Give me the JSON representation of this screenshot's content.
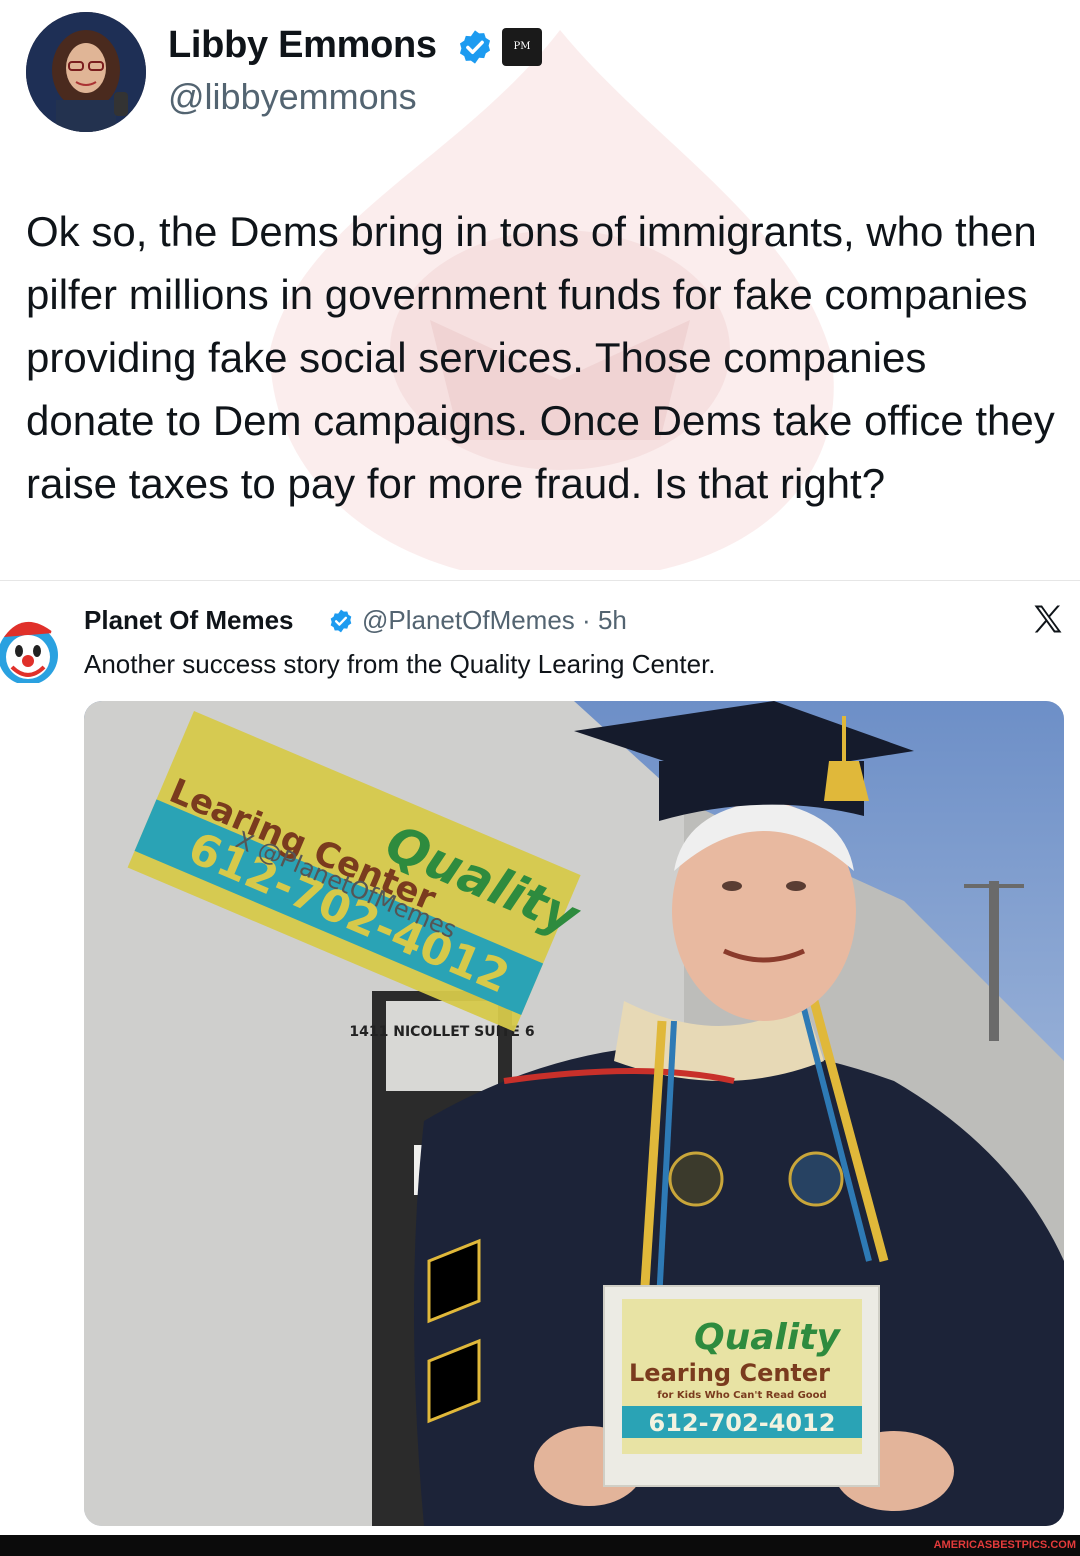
{
  "tweet": {
    "author_name": "Libby Emmons",
    "author_handle": "@libbyemmons",
    "affiliate_badge": "PM",
    "body": "Ok so, the Dems bring in tons of immigrants, who then pilfer millions in government funds for fake companies providing fake social services. Those companies donate to Dem campaigns. Once Dems take office they raise taxes to pay for more fraud. Is that right?"
  },
  "quoted_tweet": {
    "author_name": "Planet Of Memes",
    "author_handle": "@PlanetOfMemes",
    "separator": "·",
    "time": "5h",
    "text": "Another success story from the Quality Learing Center.",
    "image": {
      "wall_sign": {
        "line1": "Quality",
        "line2": "Learing Center",
        "phone": "612-702-4012",
        "watermark": "X @PlanetOfMemes"
      },
      "door_plate": "1411 NICOLLET SUITE 6",
      "held_sign": {
        "line1": "Quality",
        "line2": "Learing Center",
        "tagline": "for Kids Who Can't Read Good",
        "phone": "612-702-4012"
      }
    }
  },
  "footer": {
    "brand": "AMERICASBESTPICS.COM"
  },
  "colors": {
    "verified_blue": "#1d9bf0",
    "text_primary": "#0f1419",
    "text_secondary": "#536471",
    "sign_green": "#2e8b3e",
    "sign_teal": "#2aa3b5",
    "sign_brown": "#7a3b1e"
  },
  "icons": [
    "verified-badge-icon",
    "x-logo-icon",
    "clown-avatar-icon"
  ]
}
